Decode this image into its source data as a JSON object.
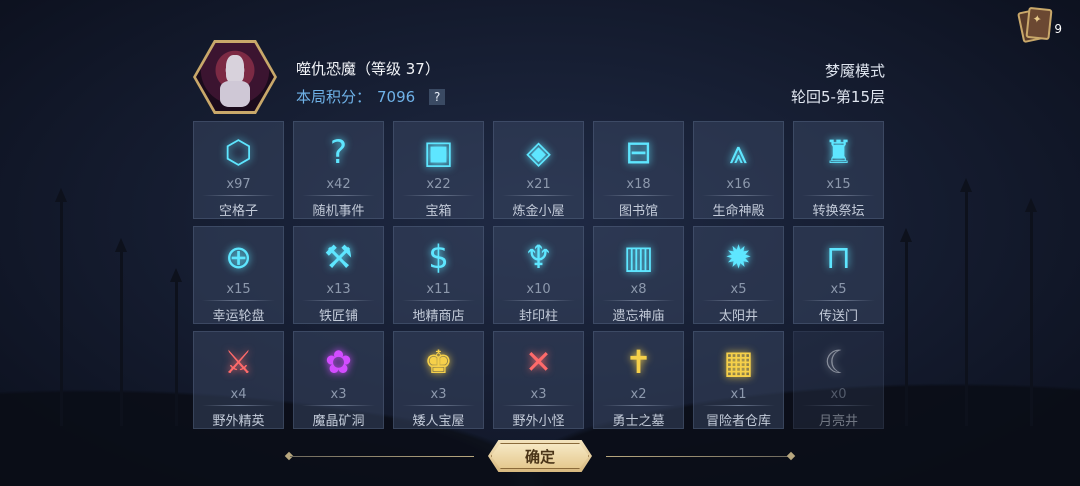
{
  "deck": {
    "count": "9",
    "icon": "card-deck-icon"
  },
  "header": {
    "boss_name": "噬仇恐魔（等级 37）",
    "score_label": "本局积分：",
    "score_value": "7096",
    "help": "?",
    "mode": "梦魇模式",
    "cycle": "轮回5-第15层"
  },
  "tiles": [
    {
      "count": "x97",
      "label": "空格子",
      "icon": "hexagon-icon",
      "glyph": "⬡",
      "color": "#5ee6ff"
    },
    {
      "count": "x42",
      "label": "随机事件",
      "icon": "question-mark-icon",
      "glyph": "?",
      "color": "#5ee6ff"
    },
    {
      "count": "x22",
      "label": "宝箱",
      "icon": "treasure-chest-icon",
      "glyph": "▣",
      "color": "#5ee6ff"
    },
    {
      "count": "x21",
      "label": "炼金小屋",
      "icon": "alchemy-icon",
      "glyph": "◈",
      "color": "#5ee6ff"
    },
    {
      "count": "x18",
      "label": "图书馆",
      "icon": "book-icon",
      "glyph": "⊟",
      "color": "#5ee6ff"
    },
    {
      "count": "x16",
      "label": "生命神殿",
      "icon": "temple-icon",
      "glyph": "⩓",
      "color": "#5ee6ff"
    },
    {
      "count": "x15",
      "label": "转换祭坛",
      "icon": "altar-icon",
      "glyph": "♜",
      "color": "#5ee6ff"
    },
    {
      "count": "x15",
      "label": "幸运轮盘",
      "icon": "roulette-icon",
      "glyph": "⊕",
      "color": "#5ee6ff"
    },
    {
      "count": "x13",
      "label": "铁匠铺",
      "icon": "anvil-icon",
      "glyph": "⚒",
      "color": "#5ee6ff"
    },
    {
      "count": "x11",
      "label": "地精商店",
      "icon": "shop-icon",
      "glyph": "$",
      "color": "#5ee6ff"
    },
    {
      "count": "x10",
      "label": "封印柱",
      "icon": "seal-pillar-icon",
      "glyph": "♆",
      "color": "#5ee6ff"
    },
    {
      "count": "x8",
      "label": "遗忘神庙",
      "icon": "forgotten-shrine-icon",
      "glyph": "▥",
      "color": "#5ee6ff"
    },
    {
      "count": "x5",
      "label": "太阳井",
      "icon": "sun-well-icon",
      "glyph": "✹",
      "color": "#5ee6ff"
    },
    {
      "count": "x5",
      "label": "传送门",
      "icon": "portal-icon",
      "glyph": "⊓",
      "color": "#5ee6ff"
    },
    {
      "count": "x4",
      "label": "野外精英",
      "icon": "crossed-axes-icon",
      "glyph": "⚔",
      "color": "#ff6a6a"
    },
    {
      "count": "x3",
      "label": "魔晶矿洞",
      "icon": "crystal-mine-icon",
      "glyph": "✿",
      "color": "#d24cff"
    },
    {
      "count": "x3",
      "label": "矮人宝屋",
      "icon": "dwarf-helmet-icon",
      "glyph": "♚",
      "color": "#f6d04a"
    },
    {
      "count": "x3",
      "label": "野外小怪",
      "icon": "crossed-swords-icon",
      "glyph": "✕",
      "color": "#ff6a6a"
    },
    {
      "count": "x2",
      "label": "勇士之墓",
      "icon": "tombstone-icon",
      "glyph": "✝",
      "color": "#f6d04a"
    },
    {
      "count": "x1",
      "label": "冒险者仓库",
      "icon": "warehouse-icon",
      "glyph": "▦",
      "color": "#f6d04a"
    },
    {
      "count": "x0",
      "label": "月亮井",
      "icon": "moon-well-icon",
      "glyph": "☾",
      "color": "#e8edf5"
    }
  ],
  "confirm_label": "确定"
}
